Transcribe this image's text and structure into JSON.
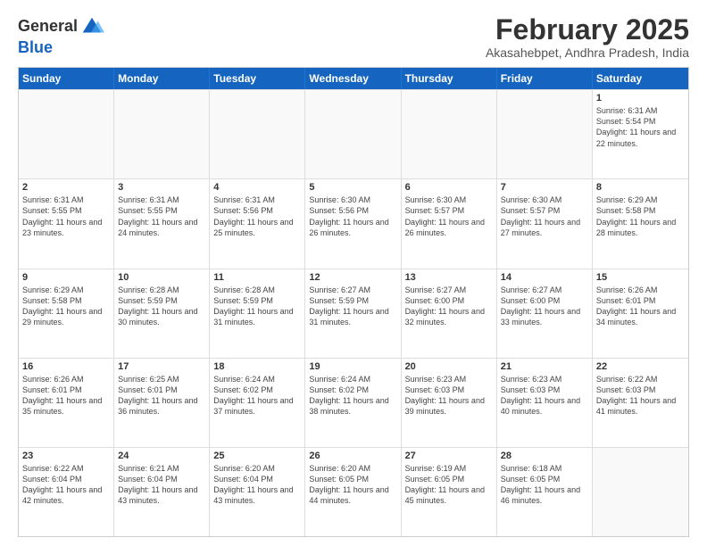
{
  "header": {
    "logo_general": "General",
    "logo_blue": "Blue",
    "month_title": "February 2025",
    "location": "Akasahebpet, Andhra Pradesh, India"
  },
  "days_of_week": [
    "Sunday",
    "Monday",
    "Tuesday",
    "Wednesday",
    "Thursday",
    "Friday",
    "Saturday"
  ],
  "weeks": [
    [
      {
        "day": "",
        "empty": true
      },
      {
        "day": "",
        "empty": true
      },
      {
        "day": "",
        "empty": true
      },
      {
        "day": "",
        "empty": true
      },
      {
        "day": "",
        "empty": true
      },
      {
        "day": "",
        "empty": true
      },
      {
        "day": "1",
        "sunrise": "Sunrise: 6:31 AM",
        "sunset": "Sunset: 5:54 PM",
        "daylight": "Daylight: 11 hours and 22 minutes."
      }
    ],
    [
      {
        "day": "2",
        "sunrise": "Sunrise: 6:31 AM",
        "sunset": "Sunset: 5:55 PM",
        "daylight": "Daylight: 11 hours and 23 minutes."
      },
      {
        "day": "3",
        "sunrise": "Sunrise: 6:31 AM",
        "sunset": "Sunset: 5:55 PM",
        "daylight": "Daylight: 11 hours and 24 minutes."
      },
      {
        "day": "4",
        "sunrise": "Sunrise: 6:31 AM",
        "sunset": "Sunset: 5:56 PM",
        "daylight": "Daylight: 11 hours and 25 minutes."
      },
      {
        "day": "5",
        "sunrise": "Sunrise: 6:30 AM",
        "sunset": "Sunset: 5:56 PM",
        "daylight": "Daylight: 11 hours and 26 minutes."
      },
      {
        "day": "6",
        "sunrise": "Sunrise: 6:30 AM",
        "sunset": "Sunset: 5:57 PM",
        "daylight": "Daylight: 11 hours and 26 minutes."
      },
      {
        "day": "7",
        "sunrise": "Sunrise: 6:30 AM",
        "sunset": "Sunset: 5:57 PM",
        "daylight": "Daylight: 11 hours and 27 minutes."
      },
      {
        "day": "8",
        "sunrise": "Sunrise: 6:29 AM",
        "sunset": "Sunset: 5:58 PM",
        "daylight": "Daylight: 11 hours and 28 minutes."
      }
    ],
    [
      {
        "day": "9",
        "sunrise": "Sunrise: 6:29 AM",
        "sunset": "Sunset: 5:58 PM",
        "daylight": "Daylight: 11 hours and 29 minutes."
      },
      {
        "day": "10",
        "sunrise": "Sunrise: 6:28 AM",
        "sunset": "Sunset: 5:59 PM",
        "daylight": "Daylight: 11 hours and 30 minutes."
      },
      {
        "day": "11",
        "sunrise": "Sunrise: 6:28 AM",
        "sunset": "Sunset: 5:59 PM",
        "daylight": "Daylight: 11 hours and 31 minutes."
      },
      {
        "day": "12",
        "sunrise": "Sunrise: 6:27 AM",
        "sunset": "Sunset: 5:59 PM",
        "daylight": "Daylight: 11 hours and 31 minutes."
      },
      {
        "day": "13",
        "sunrise": "Sunrise: 6:27 AM",
        "sunset": "Sunset: 6:00 PM",
        "daylight": "Daylight: 11 hours and 32 minutes."
      },
      {
        "day": "14",
        "sunrise": "Sunrise: 6:27 AM",
        "sunset": "Sunset: 6:00 PM",
        "daylight": "Daylight: 11 hours and 33 minutes."
      },
      {
        "day": "15",
        "sunrise": "Sunrise: 6:26 AM",
        "sunset": "Sunset: 6:01 PM",
        "daylight": "Daylight: 11 hours and 34 minutes."
      }
    ],
    [
      {
        "day": "16",
        "sunrise": "Sunrise: 6:26 AM",
        "sunset": "Sunset: 6:01 PM",
        "daylight": "Daylight: 11 hours and 35 minutes."
      },
      {
        "day": "17",
        "sunrise": "Sunrise: 6:25 AM",
        "sunset": "Sunset: 6:01 PM",
        "daylight": "Daylight: 11 hours and 36 minutes."
      },
      {
        "day": "18",
        "sunrise": "Sunrise: 6:24 AM",
        "sunset": "Sunset: 6:02 PM",
        "daylight": "Daylight: 11 hours and 37 minutes."
      },
      {
        "day": "19",
        "sunrise": "Sunrise: 6:24 AM",
        "sunset": "Sunset: 6:02 PM",
        "daylight": "Daylight: 11 hours and 38 minutes."
      },
      {
        "day": "20",
        "sunrise": "Sunrise: 6:23 AM",
        "sunset": "Sunset: 6:03 PM",
        "daylight": "Daylight: 11 hours and 39 minutes."
      },
      {
        "day": "21",
        "sunrise": "Sunrise: 6:23 AM",
        "sunset": "Sunset: 6:03 PM",
        "daylight": "Daylight: 11 hours and 40 minutes."
      },
      {
        "day": "22",
        "sunrise": "Sunrise: 6:22 AM",
        "sunset": "Sunset: 6:03 PM",
        "daylight": "Daylight: 11 hours and 41 minutes."
      }
    ],
    [
      {
        "day": "23",
        "sunrise": "Sunrise: 6:22 AM",
        "sunset": "Sunset: 6:04 PM",
        "daylight": "Daylight: 11 hours and 42 minutes."
      },
      {
        "day": "24",
        "sunrise": "Sunrise: 6:21 AM",
        "sunset": "Sunset: 6:04 PM",
        "daylight": "Daylight: 11 hours and 43 minutes."
      },
      {
        "day": "25",
        "sunrise": "Sunrise: 6:20 AM",
        "sunset": "Sunset: 6:04 PM",
        "daylight": "Daylight: 11 hours and 43 minutes."
      },
      {
        "day": "26",
        "sunrise": "Sunrise: 6:20 AM",
        "sunset": "Sunset: 6:05 PM",
        "daylight": "Daylight: 11 hours and 44 minutes."
      },
      {
        "day": "27",
        "sunrise": "Sunrise: 6:19 AM",
        "sunset": "Sunset: 6:05 PM",
        "daylight": "Daylight: 11 hours and 45 minutes."
      },
      {
        "day": "28",
        "sunrise": "Sunrise: 6:18 AM",
        "sunset": "Sunset: 6:05 PM",
        "daylight": "Daylight: 11 hours and 46 minutes."
      },
      {
        "day": "",
        "empty": true
      }
    ]
  ]
}
